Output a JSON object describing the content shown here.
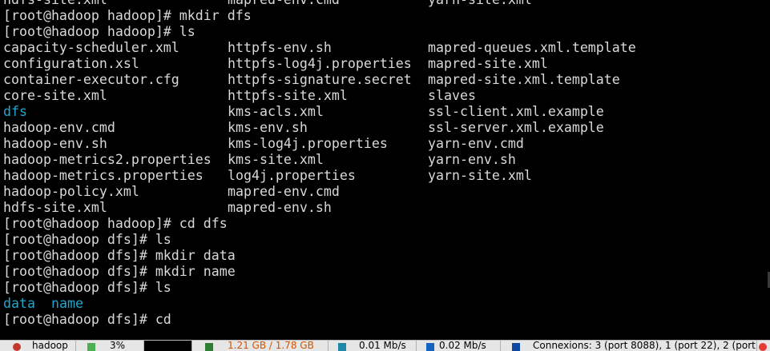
{
  "terminal": {
    "lines": {
      "l0": {
        "c1": "hdfs-site.xml",
        "c2": "mapred-env.cmd",
        "c3": "yarn-site.xml"
      },
      "l1": "[root@hadoop hadoop]# mkdir dfs",
      "l2": "[root@hadoop hadoop]# ls",
      "l3": {
        "c1": "capacity-scheduler.xml",
        "c2": "httpfs-env.sh",
        "c3": "mapred-queues.xml.template"
      },
      "l4": {
        "c1": "configuration.xsl",
        "c2": "httpfs-log4j.properties",
        "c3": "mapred-site.xml"
      },
      "l5": {
        "c1": "container-executor.cfg",
        "c2": "httpfs-signature.secret",
        "c3": "mapred-site.xml.template"
      },
      "l6": {
        "c1": "core-site.xml",
        "c2": "httpfs-site.xml",
        "c3": "slaves"
      },
      "l7": {
        "c1": "dfs",
        "c2": "kms-acls.xml",
        "c3": "ssl-client.xml.example"
      },
      "l8": {
        "c1": "hadoop-env.cmd",
        "c2": "kms-env.sh",
        "c3": "ssl-server.xml.example"
      },
      "l9": {
        "c1": "hadoop-env.sh",
        "c2": "kms-log4j.properties",
        "c3": "yarn-env.cmd"
      },
      "l10": {
        "c1": "hadoop-metrics2.properties",
        "c2": "kms-site.xml",
        "c3": "yarn-env.sh"
      },
      "l11": {
        "c1": "hadoop-metrics.properties",
        "c2": "log4j.properties",
        "c3": "yarn-site.xml"
      },
      "l12": {
        "c1": "hadoop-policy.xml",
        "c2": "mapred-env.cmd"
      },
      "l13": {
        "c1": "hdfs-site.xml",
        "c2": "mapred-env.sh"
      },
      "l14": "[root@hadoop hadoop]# cd dfs",
      "l15": "[root@hadoop dfs]# ls",
      "l16": "[root@hadoop dfs]# mkdir data",
      "l17": "[root@hadoop dfs]# mkdir name",
      "l18": "[root@hadoop dfs]# ls",
      "l19": {
        "d1": "data",
        "d2": "name"
      },
      "l20": "[root@hadoop dfs]# cd"
    },
    "colors": {
      "text": "#d9d9d9",
      "directory": "#1ca8cf",
      "background": "#000000"
    }
  },
  "statusbar": {
    "task": "hadoop",
    "cpu": "3%",
    "memory": "1.21 GB / 1.78 GB",
    "upload": "0.01 Mb/s",
    "download": "0.02 Mb/s",
    "connections": "Connexions: 3 (port 8088), 1 (port 22), 2 (port"
  }
}
